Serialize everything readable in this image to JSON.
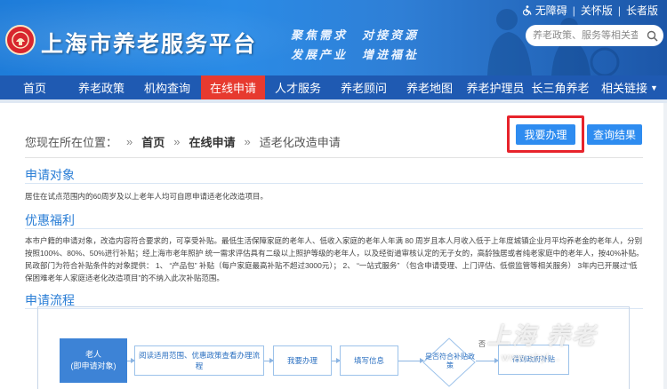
{
  "header": {
    "site_title": "上海市养老服务平台",
    "slogan_line1": "聚焦需求　对接资源",
    "slogan_line2": "发展产业　增进福祉",
    "utility_links": [
      "无障碍",
      "关怀版",
      "长者版"
    ],
    "search_placeholder": "养老政策、服务等相关查询"
  },
  "nav": {
    "items": [
      "首页",
      "养老政策",
      "机构查询",
      "在线申请",
      "人才服务",
      "养老顾问",
      "养老地图",
      "养老护理员",
      "长三角养老",
      "相关链接"
    ],
    "active_index": 3
  },
  "breadcrumb": {
    "prefix": "您现在所在位置：",
    "items": [
      "首页",
      "在线申请",
      "适老化改造申请"
    ]
  },
  "actions": {
    "apply_label": "我要办理",
    "result_label": "查询结果"
  },
  "sections": {
    "target_title": "申请对象",
    "target_text": "居住在试点范围内的60周岁及以上老年人均可自愿申请适老化改造项目。",
    "benefit_title": "优惠福利",
    "benefit_text": "本市户籍的申请对象，改造内容符合要求的，可享受补贴。最低生活保障家庭的老年人、低收入家庭的老年人年满 80 周岁且本人月收入低于上年度城镇企业月平均养老金的老年人，分别按照100%、80%、50%进行补贴；经上海市老年照护 统一需求评估具有二级以上照护等级的老年人，以及经街道审核认定的无子女的，高龄独居或者纯老家庭中的老年人，按40%补贴。民政部门为符合补贴条件的对象提供： 1、 “产品包” 补贴（每户家庭最高补贴不超过3000元）；  2、 “一站式服务” （包含申请受理、上门评估、低偿监管等相关服务） 3年内已开展过“低保困难老年人家庭适老化改造项目”的不纳入此次补贴范围。",
    "flow_title": "申请流程"
  },
  "flow": {
    "start_line1": "老人",
    "start_line2": "(即申请对象)",
    "steps": [
      "阅读适用范围、优惠政策查看办理流程",
      "我要办理",
      "填写信息"
    ],
    "decision": "是否符合补贴政策",
    "decision_mark": "否",
    "end_step": "得到政府补贴"
  },
  "watermark": {
    "main": "上海 养老",
    "sub": "www.shyl..."
  },
  "colors": {
    "nav_bg": "#1f5ab2",
    "nav_active": "#e73a2f",
    "accent": "#2e8cf0",
    "highlight": "#e7232b"
  }
}
